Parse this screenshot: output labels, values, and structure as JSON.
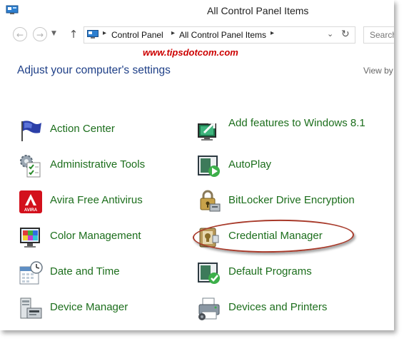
{
  "window": {
    "title": "All Control Panel Items"
  },
  "address": {
    "crumbs": [
      "Control Panel",
      "All Control Panel Items"
    ],
    "search_placeholder": "Search"
  },
  "watermark": "www.tipsdotcom.com",
  "main": {
    "heading": "Adjust your computer's settings",
    "view_by": "View by"
  },
  "items_left": [
    {
      "label": "Action Center",
      "icon": "flag-icon"
    },
    {
      "label": "Administrative Tools",
      "icon": "admin-tools-icon"
    },
    {
      "label": "Avira Free Antivirus",
      "icon": "avira-icon"
    },
    {
      "label": "Color Management",
      "icon": "color-management-icon"
    },
    {
      "label": "Date and Time",
      "icon": "calendar-clock-icon"
    },
    {
      "label": "Device Manager",
      "icon": "device-manager-icon"
    }
  ],
  "items_right": [
    {
      "label": "Add features to Windows 8.1",
      "icon": "add-features-icon"
    },
    {
      "label": "AutoPlay",
      "icon": "autoplay-icon"
    },
    {
      "label": "BitLocker Drive Encryption",
      "icon": "bitlocker-icon"
    },
    {
      "label": "Credential Manager",
      "icon": "credential-manager-icon"
    },
    {
      "label": "Default Programs",
      "icon": "default-programs-icon"
    },
    {
      "label": "Devices and Printers",
      "icon": "printer-icon"
    }
  ],
  "highlight": {
    "item": "Credential Manager",
    "color": "#a83a2a"
  }
}
